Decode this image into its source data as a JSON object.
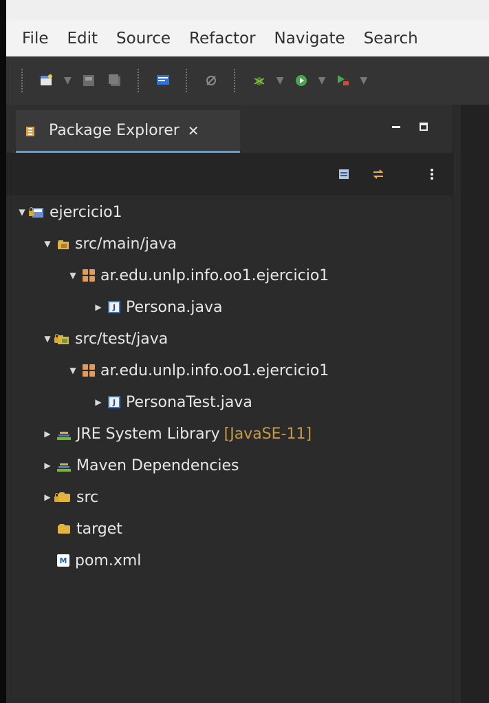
{
  "menu": {
    "items": [
      "File",
      "Edit",
      "Source",
      "Refactor",
      "Navigate",
      "Search"
    ]
  },
  "panel": {
    "tab_title": "Package Explorer",
    "close_glyph": "✕"
  },
  "tree": {
    "project": "ejercicio1",
    "src_main": "src/main/java",
    "package_main": "ar.edu.unlp.info.oo1.ejercicio1",
    "file_main": "Persona.java",
    "src_test": "src/test/java",
    "package_test": "ar.edu.unlp.info.oo1.ejercicio1",
    "file_test": "PersonaTest.java",
    "jre_library": "JRE System Library",
    "jre_decor": "[JavaSE-11]",
    "maven_deps": "Maven Dependencies",
    "src": "src",
    "target": "target",
    "pom": "pom.xml"
  },
  "icons": {
    "accent": "#5aa0d8",
    "folder": "#e2b33d",
    "package": "#e09a5a",
    "java_border": "#3a74c6",
    "decoration": "#c69a46"
  }
}
